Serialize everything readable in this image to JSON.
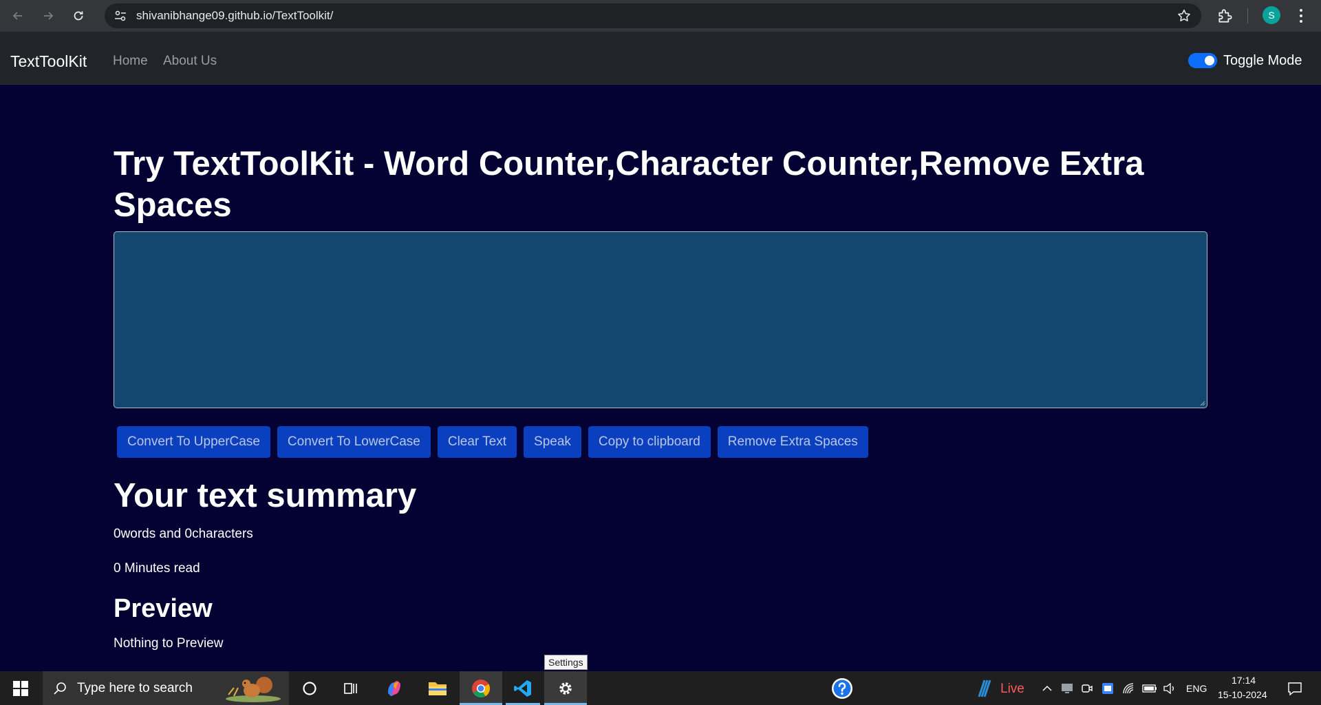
{
  "browser": {
    "url": "shivanibhange09.github.io/TextToolkit/",
    "profile_initial": "S"
  },
  "navbar": {
    "brand": "TextToolKit",
    "links": [
      "Home",
      "About Us"
    ],
    "toggle_label": "Toggle Mode",
    "toggle_on": true
  },
  "main": {
    "heading": "Try TextToolKit - Word Counter,Character Counter,Remove Extra Spaces",
    "textarea_value": "",
    "buttons": [
      "Convert To UpperCase",
      "Convert To LowerCase",
      "Clear Text",
      "Speak",
      "Copy to clipboard",
      "Remove Extra Spaces"
    ],
    "summary_title": "Your text summary",
    "word_char_count": "0words and 0characters",
    "read_time": "0 Minutes read",
    "preview_title": "Preview",
    "preview_text": "Nothing to Preview"
  },
  "tooltip": "Settings",
  "taskbar": {
    "search_placeholder": "Type here to search",
    "live_label": "Live",
    "language": "ENG",
    "time": "17:14",
    "date": "15-10-2024"
  },
  "colors": {
    "page_bg": "#040233",
    "textarea_bg": "#12476f",
    "button_bg": "#0a40bf",
    "navbar_bg": "#212529",
    "toggle_accent": "#0d6efd"
  }
}
